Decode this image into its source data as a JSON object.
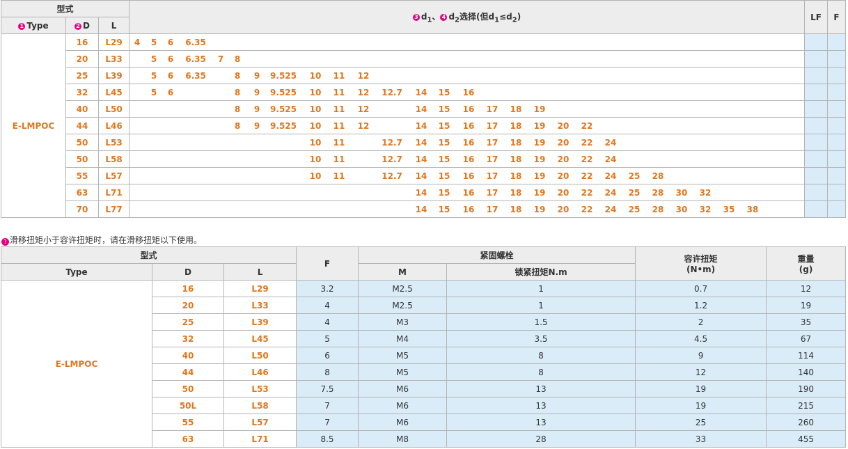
{
  "top_table": {
    "header_model": "型式",
    "header_type": "Type",
    "header_d": "D",
    "header_l": "L",
    "header_sel_prefix": "d",
    "header_sel_sub1": "1",
    "header_sel_sep": "、",
    "header_sel_d2": "d",
    "header_sel_sub2": "2",
    "header_sel_text": "选择(但d",
    "header_sel_sub3": "1",
    "header_sel_le": "≤d",
    "header_sel_sub4": "2",
    "header_sel_close": ")",
    "header_lf": "LF",
    "header_f": "F",
    "marker_1": "1",
    "marker_2": "2",
    "marker_3": "3",
    "marker_4": "4",
    "type_name": "E-LMPOC",
    "size_columns": [
      "4",
      "5",
      "6",
      "6.35",
      "7",
      "8",
      "9",
      "9.525",
      "10",
      "11",
      "12",
      "12.7",
      "14",
      "15",
      "16",
      "17",
      "18",
      "19",
      "20",
      "22",
      "24",
      "25",
      "28",
      "30",
      "32",
      "35",
      "38"
    ],
    "rows": [
      {
        "d": "16",
        "l": "L29",
        "sizes": [
          "4",
          "5",
          "6",
          "6.35"
        ]
      },
      {
        "d": "20",
        "l": "L33",
        "sizes": [
          "5",
          "6",
          "6.35",
          "7",
          "8"
        ]
      },
      {
        "d": "25",
        "l": "L39",
        "sizes": [
          "5",
          "6",
          "6.35",
          "8",
          "9",
          "9.525",
          "10",
          "11",
          "12"
        ]
      },
      {
        "d": "32",
        "l": "L45",
        "sizes": [
          "5",
          "6",
          "8",
          "9",
          "9.525",
          "10",
          "11",
          "12",
          "12.7",
          "14",
          "15",
          "16"
        ]
      },
      {
        "d": "40",
        "l": "L50",
        "sizes": [
          "8",
          "9",
          "9.525",
          "10",
          "11",
          "12",
          "14",
          "15",
          "16",
          "17",
          "18",
          "19"
        ]
      },
      {
        "d": "44",
        "l": "L46",
        "sizes": [
          "8",
          "9",
          "9.525",
          "10",
          "11",
          "12",
          "14",
          "15",
          "16",
          "17",
          "18",
          "19",
          "20",
          "22"
        ]
      },
      {
        "d": "50",
        "l": "L53",
        "sizes": [
          "10",
          "11",
          "12.7",
          "14",
          "15",
          "16",
          "17",
          "18",
          "19",
          "20",
          "22",
          "24"
        ]
      },
      {
        "d": "50",
        "l": "L58",
        "sizes": [
          "10",
          "11",
          "12.7",
          "14",
          "15",
          "16",
          "17",
          "18",
          "19",
          "20",
          "22",
          "24"
        ]
      },
      {
        "d": "55",
        "l": "L57",
        "sizes": [
          "10",
          "11",
          "12.7",
          "14",
          "15",
          "16",
          "17",
          "18",
          "19",
          "20",
          "22",
          "24",
          "25",
          "28"
        ]
      },
      {
        "d": "63",
        "l": "L71",
        "sizes": [
          "14",
          "15",
          "16",
          "17",
          "18",
          "19",
          "20",
          "22",
          "24",
          "25",
          "28",
          "30",
          "32"
        ]
      },
      {
        "d": "70",
        "l": "L77",
        "sizes": [
          "14",
          "15",
          "16",
          "17",
          "18",
          "19",
          "20",
          "22",
          "24",
          "25",
          "28",
          "30",
          "32",
          "35",
          "38"
        ]
      }
    ]
  },
  "note": {
    "mark": "?",
    "text": "滑移扭矩小于容许扭矩时，请在滑移扭矩以下使用。"
  },
  "bottom_table": {
    "header_model": "型式",
    "header_type": "Type",
    "header_d": "D",
    "header_l": "L",
    "header_f": "F",
    "header_bolt": "紧固螺栓",
    "header_m": "M",
    "header_torque_lock": "锁紧扭矩N.m",
    "header_allow": "容许扭矩",
    "header_allow_unit": "(N•m)",
    "header_weight": "重量",
    "header_weight_unit": "(g)",
    "type_name": "E-LMPOC",
    "rows": [
      {
        "d": "16",
        "l": "L29",
        "f": "3.2",
        "m": "M2.5",
        "lock": "1",
        "allow": "0.7",
        "weight": "12"
      },
      {
        "d": "20",
        "l": "L33",
        "f": "4",
        "m": "M2.5",
        "lock": "1",
        "allow": "1.2",
        "weight": "19"
      },
      {
        "d": "25",
        "l": "L39",
        "f": "4",
        "m": "M3",
        "lock": "1.5",
        "allow": "2",
        "weight": "35"
      },
      {
        "d": "32",
        "l": "L45",
        "f": "5",
        "m": "M4",
        "lock": "3.5",
        "allow": "4.5",
        "weight": "67"
      },
      {
        "d": "40",
        "l": "L50",
        "f": "6",
        "m": "M5",
        "lock": "8",
        "allow": "9",
        "weight": "114"
      },
      {
        "d": "44",
        "l": "L46",
        "f": "8",
        "m": "M5",
        "lock": "8",
        "allow": "12",
        "weight": "140"
      },
      {
        "d": "50",
        "l": "L53",
        "f": "7.5",
        "m": "M6",
        "lock": "13",
        "allow": "19",
        "weight": "190"
      },
      {
        "d": "50L",
        "l": "L58",
        "f": "7",
        "m": "M6",
        "lock": "13",
        "allow": "19",
        "weight": "215"
      },
      {
        "d": "55",
        "l": "L57",
        "f": "7",
        "m": "M6",
        "lock": "13",
        "allow": "25",
        "weight": "260"
      },
      {
        "d": "63",
        "l": "L71",
        "f": "8.5",
        "m": "M8",
        "lock": "28",
        "allow": "33",
        "weight": "455"
      }
    ]
  }
}
